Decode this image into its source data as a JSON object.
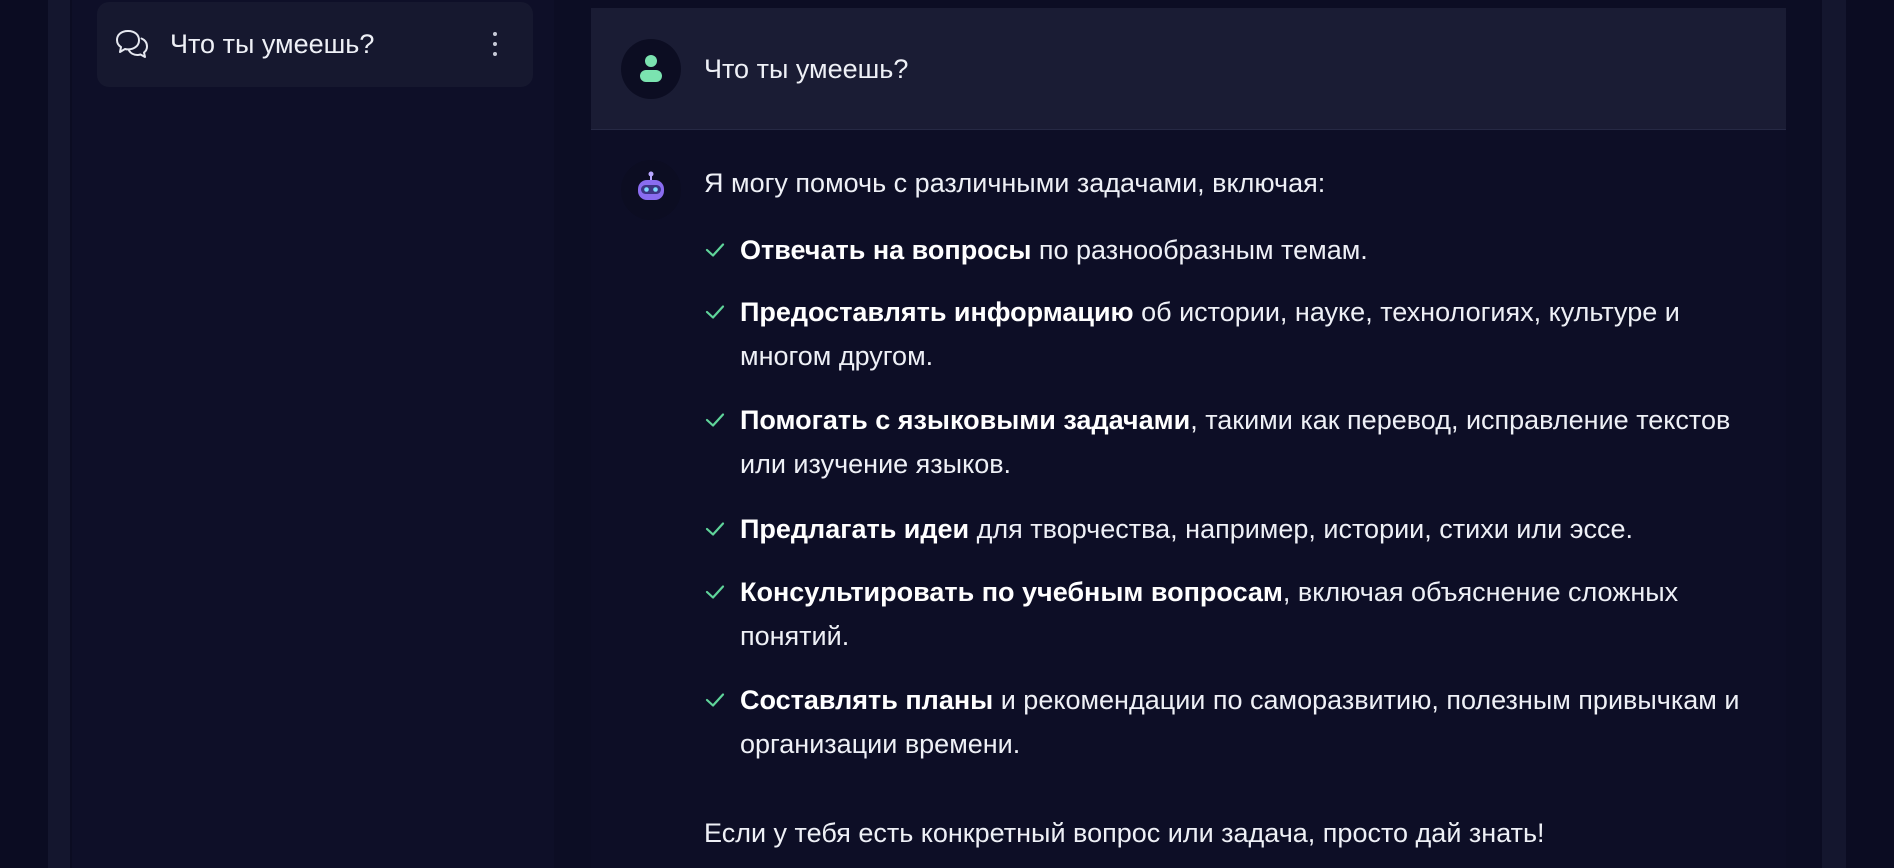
{
  "sidebar": {
    "chats": [
      {
        "title": "Что ты умеешь?",
        "icon": "chat-bubbles-icon",
        "menu_icon": "more-vertical-icon"
      }
    ]
  },
  "conversation": {
    "user_message": {
      "avatar_icon": "user-icon",
      "text": "Что ты умеешь?"
    },
    "bot_message": {
      "avatar_icon": "robot-icon",
      "intro": "Я могу помочь с различными задачами, включая:",
      "items": [
        {
          "bold": "Отвечать на вопросы",
          "rest": " по разнообразным темам."
        },
        {
          "bold": "Предоставлять информацию",
          "rest": " об истории, науке, технологиях, культуре и многом другом."
        },
        {
          "bold": "Помогать с языковыми задачами",
          "rest": ", такими как перевод, исправление текстов или изучение языков."
        },
        {
          "bold": "Предлагать идеи",
          "rest": " для творчества, например, истории, стихи или эссе."
        },
        {
          "bold": "Консультировать по учебным вопросам",
          "rest": ", включая объяснение сложных понятий."
        },
        {
          "bold": "Составлять планы",
          "rest": " и рекомендации по саморазвитию, полезным привычкам и организации времени."
        }
      ],
      "outro": "Если у тебя есть конкретный вопрос или задача, просто дай знать!"
    }
  },
  "colors": {
    "background": "#0b0c22",
    "sidebar": "#0e0f28",
    "chat_item": "#16182f",
    "user_bubble": "#1a1c34",
    "accent_green": "#5fd49a",
    "robot_purple": "#8a6cf0"
  }
}
